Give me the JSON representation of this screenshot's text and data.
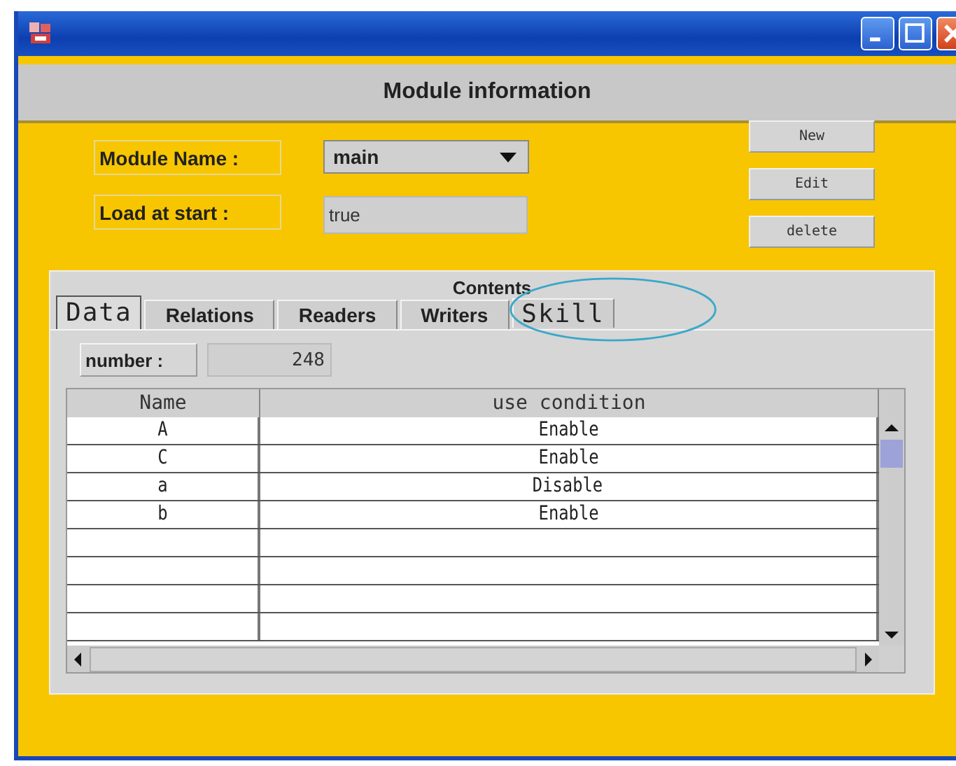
{
  "window": {
    "title": "Module information"
  },
  "form": {
    "module_name_label": "Module Name :",
    "module_name": "main",
    "load_label": "Load at start :",
    "load_value": "true"
  },
  "buttons": [
    "New",
    "Edit",
    "delete"
  ],
  "contents": {
    "title": "Contents",
    "tabs": [
      {
        "label": "Data",
        "selected": true,
        "highlighted": false
      },
      {
        "label": "Relations",
        "selected": false,
        "highlighted": false
      },
      {
        "label": "Readers",
        "selected": false,
        "highlighted": false
      },
      {
        "label": "Writers",
        "selected": false,
        "highlighted": false
      },
      {
        "label": "Skill",
        "selected": false,
        "highlighted": true
      }
    ],
    "number_label": "number :",
    "number": "248",
    "table": {
      "columns": [
        "Name",
        "use condition"
      ],
      "rows": [
        [
          "A",
          "Enable"
        ],
        [
          "C",
          "Enable"
        ],
        [
          "a",
          "Disable"
        ],
        [
          "b",
          "Enable"
        ]
      ]
    }
  }
}
